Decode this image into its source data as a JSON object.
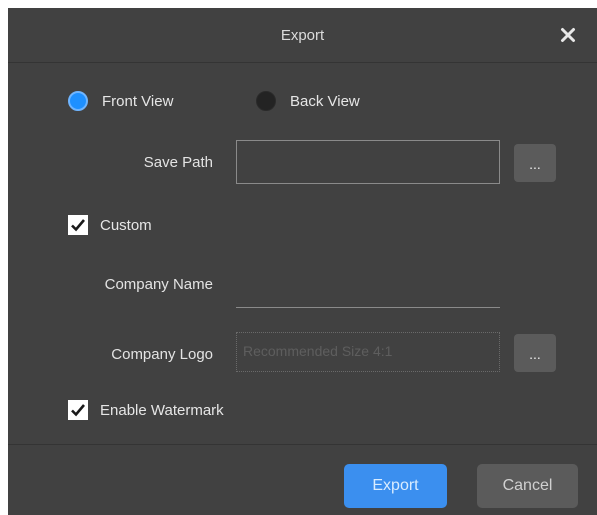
{
  "dialog": {
    "title": "Export",
    "close_icon": "close-icon"
  },
  "view": {
    "options": [
      {
        "label": "Front View",
        "selected": true
      },
      {
        "label": "Back View",
        "selected": false
      }
    ]
  },
  "save_path": {
    "label": "Save Path",
    "value": "",
    "browse_label": "..."
  },
  "custom": {
    "label": "Custom",
    "checked": true
  },
  "company_name": {
    "label": "Company Name",
    "value": ""
  },
  "company_logo": {
    "label": "Company Logo",
    "placeholder": "Recommended Size 4:1",
    "browse_label": "..."
  },
  "watermark": {
    "label": "Enable Watermark",
    "checked": true
  },
  "buttons": {
    "export_label": "Export",
    "cancel_label": "Cancel"
  },
  "colors": {
    "background": "#414141",
    "accent": "#3b8fef",
    "radio_selected": "#1e90ff",
    "secondary_button": "#5b5b5b"
  }
}
